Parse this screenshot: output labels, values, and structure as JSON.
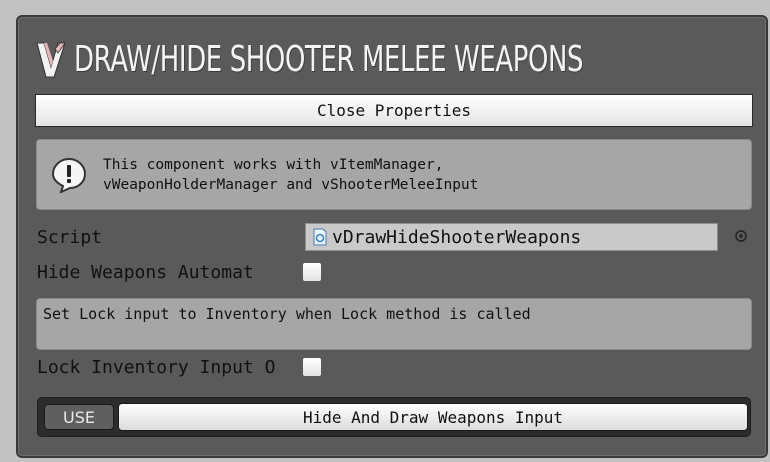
{
  "header": {
    "title": "DRAW/HIDE SHOOTER MELEE WEAPONS",
    "logo_icon": "v-logo-icon"
  },
  "close_button": {
    "label": "Close Properties"
  },
  "help_box": {
    "icon": "info-icon",
    "text": "This component works with vItemManager,\nvWeaponHolderManager and vShooterMeleeInput"
  },
  "fields": {
    "script": {
      "label": "Script",
      "value": "vDrawHideShooterWeapons",
      "icon": "script-icon"
    },
    "hide_weapons": {
      "label": "Hide Weapons Automat",
      "checked": false
    },
    "lock_help": {
      "text": "Set Lock input to Inventory when Lock method is called"
    },
    "lock_inventory": {
      "label": "Lock Inventory Input O",
      "checked": false
    }
  },
  "input_bar": {
    "use_label": "USE",
    "button_label": "Hide And Draw Weapons Input"
  },
  "colors": {
    "panel_bg": "#5a5a5a",
    "page_bg": "#c2c2c2",
    "help_bg": "#a6a6a6",
    "logo_white": "#f2f2f2",
    "logo_accent": "#e8b4b4"
  }
}
